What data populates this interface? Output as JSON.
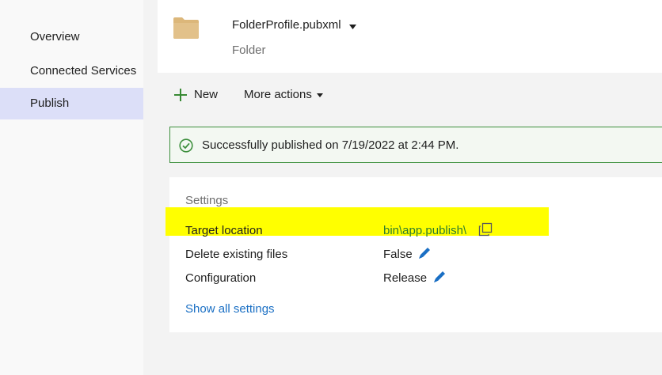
{
  "sidebar": {
    "items": [
      {
        "label": "Overview",
        "selected": false
      },
      {
        "label": "Connected Services",
        "selected": false
      },
      {
        "label": "Publish",
        "selected": true
      }
    ]
  },
  "profile": {
    "name": "FolderProfile.pubxml",
    "type": "Folder",
    "icon": "folder-icon",
    "folder_color": "#e2c18a"
  },
  "toolbar": {
    "new_label": "New",
    "more_actions_label": "More actions"
  },
  "status": {
    "message": "Successfully published on 7/19/2022 at 2:44 PM.",
    "color": "#3d8f3d"
  },
  "settings": {
    "title": "Settings",
    "rows": [
      {
        "label": "Target location",
        "value": "bin\\app.publish\\",
        "action_icon": "copy-icon"
      },
      {
        "label": "Delete existing files",
        "value": "False",
        "action_icon": "edit-icon"
      },
      {
        "label": "Configuration",
        "value": "Release",
        "action_icon": "edit-icon"
      }
    ],
    "show_all_label": "Show all settings"
  },
  "colors": {
    "highlight": "#ffff00",
    "selected_nav": "#dcdff8",
    "link_blue": "#1a6fc4",
    "edit_icon": "#1a6fc4"
  }
}
